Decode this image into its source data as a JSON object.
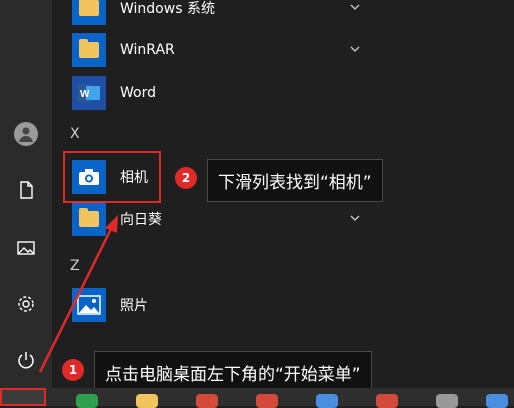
{
  "apps": [
    {
      "label": "Windows 系统",
      "icon": "folder-icon",
      "expandable": true
    },
    {
      "label": "WinRAR",
      "icon": "folder-icon",
      "expandable": true
    },
    {
      "label": "Word",
      "icon": "word-icon",
      "expandable": false
    },
    {
      "label": "相机",
      "icon": "camera-icon",
      "expandable": false
    },
    {
      "label": "向日葵",
      "icon": "folder-icon",
      "expandable": true
    },
    {
      "label": "照片",
      "icon": "photos-icon",
      "expandable": false
    }
  ],
  "sections": {
    "x": "X",
    "z": "Z"
  },
  "annotations": [
    {
      "step": "1",
      "text": "点击电脑桌面左下角的“开始菜单”"
    },
    {
      "step": "2",
      "text": "下滑列表找到“相机”"
    }
  ],
  "colors": {
    "accent": "#e02a2a",
    "tile_blue": "#0a64c7",
    "folder": "#f2c45d"
  }
}
